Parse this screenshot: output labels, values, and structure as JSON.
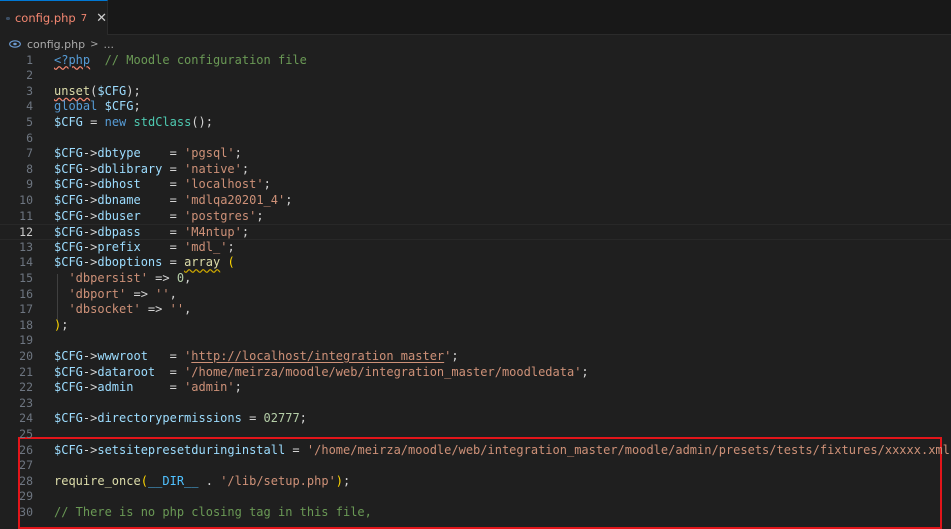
{
  "tab": {
    "title": "config.php",
    "problem_count": "7",
    "close_glyph": "✕",
    "icon": "php-elephant-icon"
  },
  "breadcrumb": {
    "file": "config.php",
    "separator": ">",
    "more": "..."
  },
  "active_line": 12,
  "highlighted_lines": [
    26
  ],
  "lines": [
    {
      "n": "1",
      "tokens": [
        [
          "t-tag squig",
          "<?php"
        ],
        [
          "t-op",
          "  "
        ],
        [
          "t-cmt",
          "// Moodle configuration file"
        ]
      ]
    },
    {
      "n": "2",
      "tokens": []
    },
    {
      "n": "3",
      "tokens": [
        [
          "t-fn squig",
          "unset"
        ],
        [
          "t-op",
          "("
        ],
        [
          "t-var",
          "$CFG"
        ],
        [
          "t-op",
          ");"
        ]
      ]
    },
    {
      "n": "4",
      "tokens": [
        [
          "t-kw",
          "global"
        ],
        [
          "t-op",
          " "
        ],
        [
          "t-var",
          "$CFG"
        ],
        [
          "t-op",
          ";"
        ]
      ]
    },
    {
      "n": "5",
      "tokens": [
        [
          "t-var",
          "$CFG"
        ],
        [
          "t-op",
          " = "
        ],
        [
          "t-kw",
          "new"
        ],
        [
          "t-op",
          " "
        ],
        [
          "t-cls",
          "stdClass"
        ],
        [
          "t-op",
          "();"
        ]
      ]
    },
    {
      "n": "6",
      "tokens": []
    },
    {
      "n": "7",
      "tokens": [
        [
          "t-var",
          "$CFG"
        ],
        [
          "t-op",
          "->"
        ],
        [
          "t-var",
          "dbtype"
        ],
        [
          "t-op",
          "    = "
        ],
        [
          "t-str",
          "'pgsql'"
        ],
        [
          "t-op",
          ";"
        ]
      ]
    },
    {
      "n": "8",
      "tokens": [
        [
          "t-var",
          "$CFG"
        ],
        [
          "t-op",
          "->"
        ],
        [
          "t-var",
          "dblibrary"
        ],
        [
          "t-op",
          " = "
        ],
        [
          "t-str",
          "'native'"
        ],
        [
          "t-op",
          ";"
        ]
      ]
    },
    {
      "n": "9",
      "tokens": [
        [
          "t-var",
          "$CFG"
        ],
        [
          "t-op",
          "->"
        ],
        [
          "t-var",
          "dbhost"
        ],
        [
          "t-op",
          "    = "
        ],
        [
          "t-str",
          "'localhost'"
        ],
        [
          "t-op",
          ";"
        ]
      ]
    },
    {
      "n": "10",
      "tokens": [
        [
          "t-var",
          "$CFG"
        ],
        [
          "t-op",
          "->"
        ],
        [
          "t-var",
          "dbname"
        ],
        [
          "t-op",
          "    = "
        ],
        [
          "t-str",
          "'mdlqa20201_4'"
        ],
        [
          "t-op",
          ";"
        ]
      ]
    },
    {
      "n": "11",
      "tokens": [
        [
          "t-var",
          "$CFG"
        ],
        [
          "t-op",
          "->"
        ],
        [
          "t-var",
          "dbuser"
        ],
        [
          "t-op",
          "    = "
        ],
        [
          "t-str",
          "'postgres'"
        ],
        [
          "t-op",
          ";"
        ]
      ]
    },
    {
      "n": "12",
      "tokens": [
        [
          "t-var",
          "$CFG"
        ],
        [
          "t-op",
          "->"
        ],
        [
          "t-var",
          "dbpass"
        ],
        [
          "t-op",
          "    = "
        ],
        [
          "t-str",
          "'M4ntup'"
        ],
        [
          "t-op",
          ";"
        ]
      ]
    },
    {
      "n": "13",
      "tokens": [
        [
          "t-var",
          "$CFG"
        ],
        [
          "t-op",
          "->"
        ],
        [
          "t-var",
          "prefix"
        ],
        [
          "t-op",
          "    = "
        ],
        [
          "t-str",
          "'mdl_'"
        ],
        [
          "t-op",
          ";"
        ]
      ]
    },
    {
      "n": "14",
      "tokens": [
        [
          "t-var",
          "$CFG"
        ],
        [
          "t-op",
          "->"
        ],
        [
          "t-var",
          "dboptions"
        ],
        [
          "t-op",
          " = "
        ],
        [
          "t-fn squig-y",
          "array"
        ],
        [
          "t-op",
          " "
        ],
        [
          "t-paren",
          "("
        ]
      ]
    },
    {
      "n": "15",
      "tokens": [
        [
          "t-op",
          "  "
        ],
        [
          "t-str",
          "'dbpersist'"
        ],
        [
          "t-op",
          " => "
        ],
        [
          "t-num",
          "0"
        ],
        [
          "t-op",
          ","
        ]
      ]
    },
    {
      "n": "16",
      "tokens": [
        [
          "t-op",
          "  "
        ],
        [
          "t-str",
          "'dbport'"
        ],
        [
          "t-op",
          " => "
        ],
        [
          "t-str",
          "''"
        ],
        [
          "t-op",
          ","
        ]
      ]
    },
    {
      "n": "17",
      "tokens": [
        [
          "t-op",
          "  "
        ],
        [
          "t-str",
          "'dbsocket'"
        ],
        [
          "t-op",
          " => "
        ],
        [
          "t-str",
          "''"
        ],
        [
          "t-op",
          ","
        ]
      ]
    },
    {
      "n": "18",
      "tokens": [
        [
          "t-paren",
          ")"
        ],
        [
          "t-op",
          ";"
        ]
      ]
    },
    {
      "n": "19",
      "tokens": []
    },
    {
      "n": "20",
      "tokens": [
        [
          "t-var",
          "$CFG"
        ],
        [
          "t-op",
          "->"
        ],
        [
          "t-var",
          "wwwroot"
        ],
        [
          "t-op",
          "   = "
        ],
        [
          "t-str",
          "'"
        ],
        [
          "t-str uline",
          "http://localhost/integration_master"
        ],
        [
          "t-str",
          "'"
        ],
        [
          "t-op",
          ";"
        ]
      ]
    },
    {
      "n": "21",
      "tokens": [
        [
          "t-var",
          "$CFG"
        ],
        [
          "t-op",
          "->"
        ],
        [
          "t-var",
          "dataroot"
        ],
        [
          "t-op",
          "  = "
        ],
        [
          "t-str",
          "'/home/meirza/moodle/web/integration_master/moodledata'"
        ],
        [
          "t-op",
          ";"
        ]
      ]
    },
    {
      "n": "22",
      "tokens": [
        [
          "t-var",
          "$CFG"
        ],
        [
          "t-op",
          "->"
        ],
        [
          "t-var",
          "admin"
        ],
        [
          "t-op",
          "     = "
        ],
        [
          "t-str",
          "'admin'"
        ],
        [
          "t-op",
          ";"
        ]
      ]
    },
    {
      "n": "23",
      "tokens": []
    },
    {
      "n": "24",
      "tokens": [
        [
          "t-var",
          "$CFG"
        ],
        [
          "t-op",
          "->"
        ],
        [
          "t-var",
          "directorypermissions"
        ],
        [
          "t-op",
          " = "
        ],
        [
          "t-num",
          "02777"
        ],
        [
          "t-op",
          ";"
        ]
      ]
    },
    {
      "n": "25",
      "tokens": []
    },
    {
      "n": "26",
      "tokens": [
        [
          "t-var",
          "$CFG"
        ],
        [
          "t-op",
          "->"
        ],
        [
          "t-var",
          "setsitepresetduringinstall"
        ],
        [
          "t-op",
          " = "
        ],
        [
          "t-str",
          "'/home/meirza/moodle/web/integration_master/moodle/admin/presets/tests/fixtures/xxxxx.xml'"
        ],
        [
          "t-op",
          ";"
        ]
      ]
    },
    {
      "n": "27",
      "tokens": []
    },
    {
      "n": "28",
      "tokens": [
        [
          "t-fn",
          "require_once"
        ],
        [
          "t-paren",
          "("
        ],
        [
          "t-const",
          "__DIR__"
        ],
        [
          "t-op",
          " . "
        ],
        [
          "t-str",
          "'/lib/setup.php'"
        ],
        [
          "t-paren",
          ")"
        ],
        [
          "t-op",
          ";"
        ]
      ]
    },
    {
      "n": "29",
      "tokens": []
    },
    {
      "n": "30",
      "tokens": [
        [
          "t-cmt",
          "// There is no php closing tag in this file,"
        ]
      ]
    }
  ]
}
